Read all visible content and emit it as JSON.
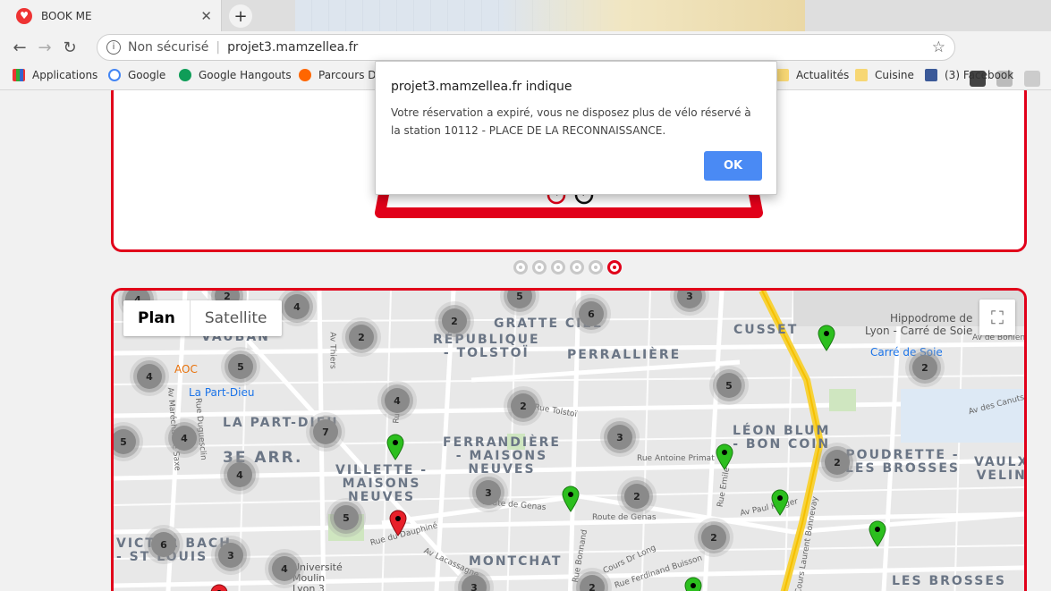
{
  "tab": {
    "title": "BOOK ME",
    "close": "✕",
    "new": "+"
  },
  "toolbar": {
    "back": "←",
    "forward": "→",
    "reload": "↻",
    "security": "Non sécurisé",
    "url": "projet3.mamzellea.fr",
    "star": "☆"
  },
  "bookmarks": [
    "Applications",
    "Google",
    "Google Hangouts",
    "Parcours Dé",
    "Actualités",
    "Cuisine",
    "(3) Facebook"
  ],
  "dialog": {
    "title": "projet3.mamzellea.fr indique",
    "message": "Votre réservation a expiré, vous ne disposez plus de vélo réservé à la station 10112 - PLACE DE LA RECONNAISSANCE.",
    "ok": "OK"
  },
  "map": {
    "types": [
      "Plan",
      "Satellite"
    ],
    "fullscreen": "⛶",
    "areas": [
      "GRATTE CIEL",
      "RÉPUBLIQUE\n- TOLSTOÏ",
      "PERRALLIÈRE",
      "CUSSET",
      "VAUBAN",
      "LA PART-DIEU",
      "3E ARR.",
      "FERRANDIÈRE\n- MAISONS\nNEUVES",
      "VILLETTE -\nMAISONS\nNEUVES",
      "LÉON BLUM\n- BON COIN",
      "POUDRETTE -\nLES BROSSES",
      "VAULX\nVELIN",
      "MONTCHAT",
      "VICTOR BACH\n- ST LOUIS",
      "LES BROSSES"
    ],
    "streets": [
      "Av Thiers",
      "Rue Tolstoï",
      "Rue Antoine Primat",
      "Route de Genas",
      "Route de Genas",
      "Av Paul Krüger",
      "Rue du Dauphiné",
      "Av Lacassagne",
      "Cours Dr Long",
      "Rue Ferdinand Buisson",
      "Rue Bonnand",
      "Rue Emile",
      "Cours Laurent Bonnevay",
      "Av des Canuts",
      "Av de Bohlen",
      "Av Maréchal de Saxe",
      "Rue Duguesclin",
      "Rue Ba"
    ],
    "pois": [
      "Hippodrome de\nLyon - Carré de Soie",
      "Carré de Soie",
      "AOC",
      "La Part-Dieu",
      "Université\nMoulin\nLyon 3"
    ],
    "clusters": [
      "4",
      "2",
      "4",
      "2",
      "5",
      "6",
      "3",
      "2",
      "4",
      "5",
      "4",
      "2",
      "5",
      "7",
      "4",
      "2",
      "3",
      "5",
      "4",
      "2",
      "3",
      "2",
      "5",
      "6",
      "3",
      "4",
      "3",
      "2",
      "2"
    ]
  }
}
